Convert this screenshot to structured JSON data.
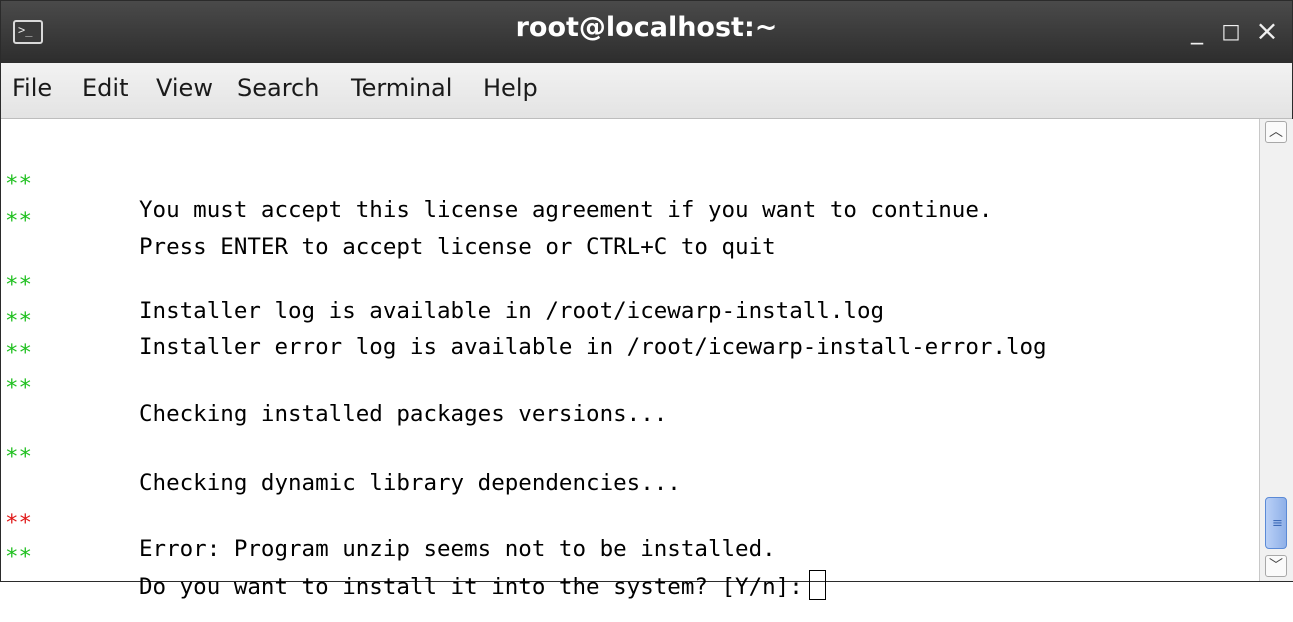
{
  "window": {
    "title": "root@localhost:~",
    "icon": "terminal-icon",
    "controls": {
      "minimize": "_",
      "maximize": "□",
      "close": "×"
    }
  },
  "menu": [
    "File",
    "Edit",
    "View",
    "Search",
    "Terminal",
    "Help"
  ],
  "terminal": {
    "lines": [
      {
        "marker": "**",
        "marker_color": "#20c020",
        "text": "You must accept this license agreement if you want to continue."
      },
      {
        "marker": "**",
        "marker_color": "#20c020",
        "text": "Press ENTER to accept license or CTRL+C to quit"
      },
      {
        "marker": "**",
        "marker_color": "#20c020",
        "text": "Installer log is available in /root/icewarp-install.log"
      },
      {
        "marker": "**",
        "marker_color": "#20c020",
        "text": "Installer error log is available in /root/icewarp-install-error.log"
      },
      {
        "marker": "**",
        "marker_color": "#20c020",
        "text": ""
      },
      {
        "marker": "**",
        "marker_color": "#20c020",
        "text": "Checking installed packages versions..."
      },
      {
        "marker": "**",
        "marker_color": "#20c020",
        "text": "Checking dynamic library dependencies..."
      },
      {
        "marker": "**",
        "marker_color": "#e01818",
        "text": "Error: Program unzip seems not to be installed."
      },
      {
        "marker": "**",
        "marker_color": "#20c020",
        "text": "Do you want to install it into the system? [Y/n]:"
      }
    ]
  },
  "scrollbar": {
    "up_icon": "chevron-up-icon",
    "down_icon": "chevron-down-icon",
    "position": 0.95
  }
}
